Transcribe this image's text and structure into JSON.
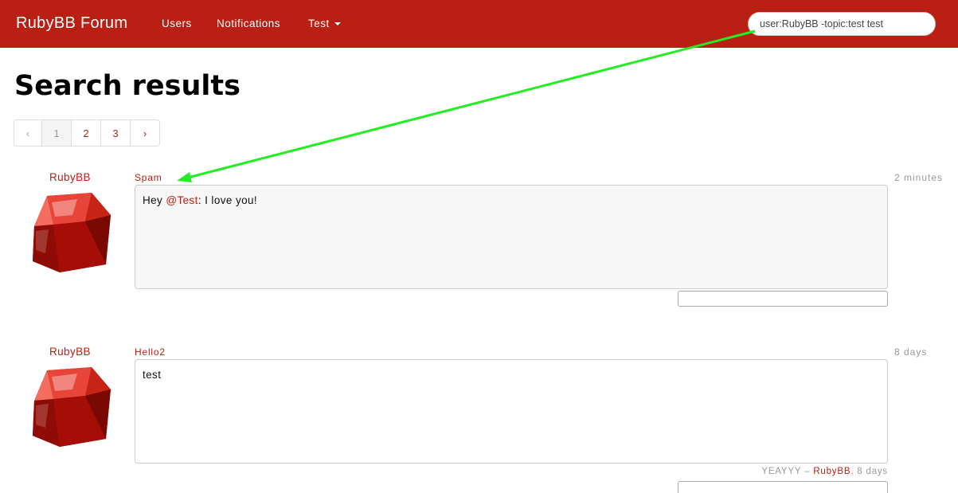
{
  "navbar": {
    "brand": "RubyBB Forum",
    "links": [
      "Users",
      "Notifications"
    ],
    "dropdown_label": "Test",
    "search_value": "user:RubyBB -topic:test test"
  },
  "page_title": "Search results",
  "pagination": {
    "prev": "‹",
    "pages": [
      "1",
      "2",
      "3"
    ],
    "next": "›",
    "active_page": "1"
  },
  "posts": [
    {
      "author": "RubyBB",
      "topic": "Spam",
      "time": "2 minutes",
      "body_prefix": "Hey ",
      "mention": "@Test",
      "body_suffix": ": I love you!"
    },
    {
      "author": "RubyBB",
      "topic": "Hello2",
      "time": "8 days",
      "body_prefix": "test",
      "signature_text": "YEAYYY – ",
      "signature_user": "RubyBB",
      "signature_time": ", 8 days"
    }
  ],
  "colors": {
    "brand_red": "#b91f12",
    "annotation_green": "#22ee22"
  },
  "icons": [
    "ruby-gem-icon",
    "caret-down-icon",
    "annotation-arrow"
  ]
}
